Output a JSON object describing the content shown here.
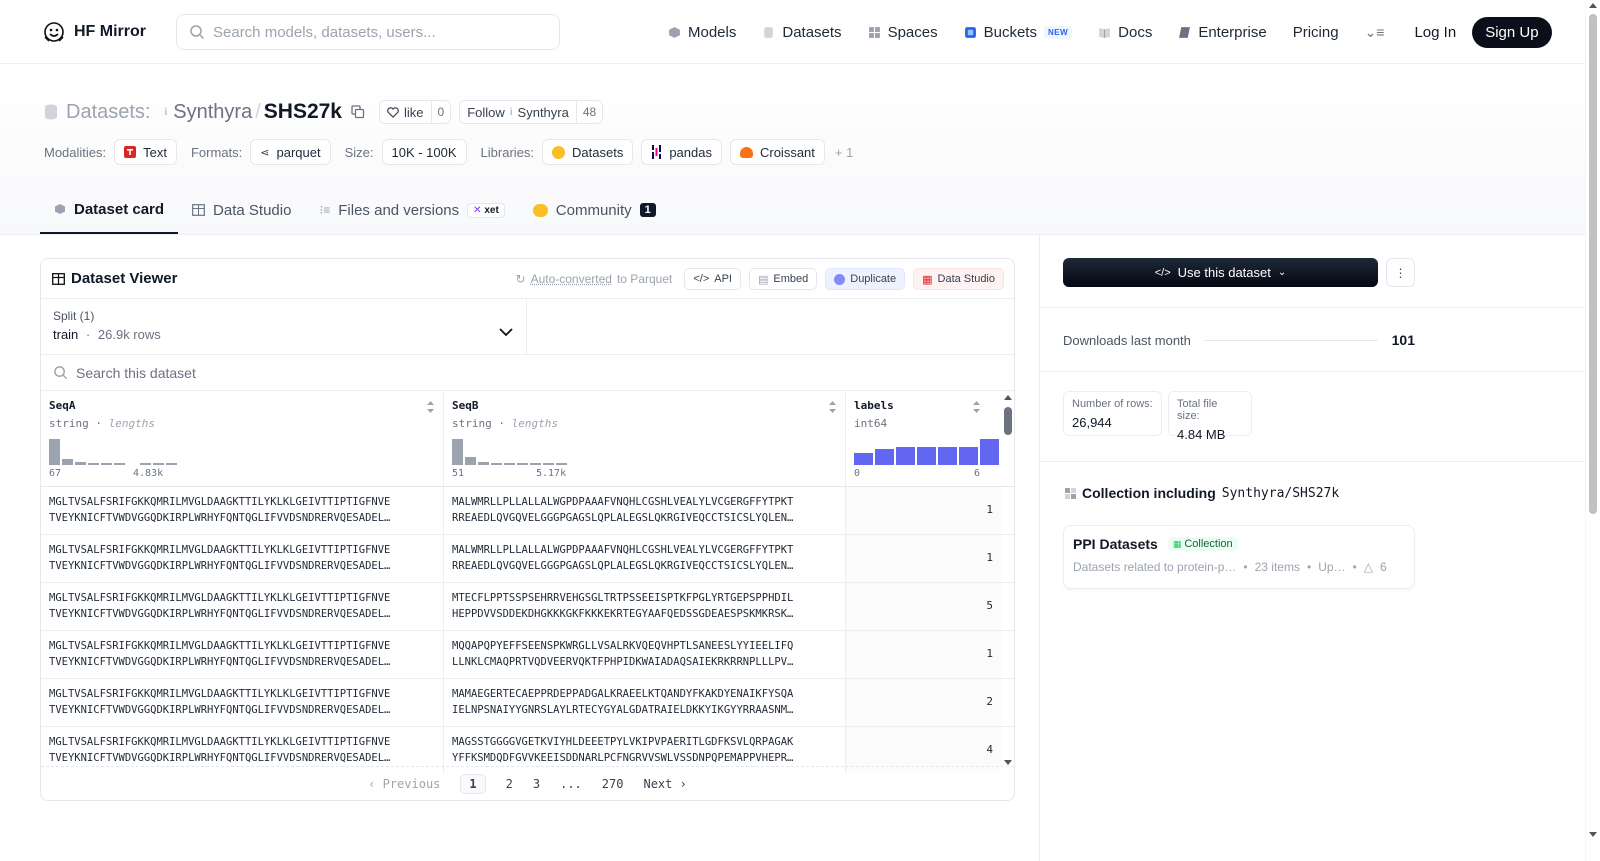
{
  "nav": {
    "brand": "HF Mirror",
    "search_placeholder": "Search models, datasets, users...",
    "links": [
      {
        "label": "Models"
      },
      {
        "label": "Datasets"
      },
      {
        "label": "Spaces"
      },
      {
        "label": "Buckets",
        "badge": "NEW"
      },
      {
        "label": "Docs"
      },
      {
        "label": "Enterprise"
      },
      {
        "label": "Pricing"
      }
    ],
    "login": "Log In",
    "signup": "Sign Up"
  },
  "header": {
    "datasets_label": "Datasets:",
    "org": "Synthyra",
    "slash": "/",
    "name": "SHS27k",
    "like_label": "like",
    "like_count": "0",
    "follow_label": "Follow",
    "follow_org": "Synthyra",
    "follow_count": "48",
    "modalities_label": "Modalities:",
    "modality": "Text",
    "formats_label": "Formats:",
    "format": "parquet",
    "size_label": "Size:",
    "size": "10K - 100K",
    "libraries_label": "Libraries:",
    "libraries": [
      "Datasets",
      "pandas",
      "Croissant"
    ],
    "more_libraries": "+ 1"
  },
  "tabs": {
    "card": "Dataset card",
    "studio": "Data Studio",
    "files": "Files and versions",
    "xet": "xet",
    "community": "Community",
    "community_count": "1"
  },
  "viewer": {
    "title": "Dataset Viewer",
    "auto_converted": "Auto-converted",
    "to_parquet": "to Parquet",
    "api": "API",
    "embed": "Embed",
    "duplicate": "Duplicate",
    "data_studio": "Data Studio",
    "split_label": "Split (1)",
    "split_name": "train",
    "split_sep": "·",
    "split_rows": "26.9k rows",
    "search_placeholder": "Search this dataset",
    "columns": [
      {
        "name": "SeqA",
        "type": "string",
        "stat": "lengths",
        "min": "67",
        "max": "4.83k",
        "hist": [
          1.0,
          0.22,
          0.1,
          0.06,
          0.05,
          0.04,
          0,
          0.04,
          0.04,
          0.04
        ]
      },
      {
        "name": "SeqB",
        "type": "string",
        "stat": "lengths",
        "min": "51",
        "max": "5.17k",
        "hist": [
          1.0,
          0.3,
          0.1,
          0.06,
          0.05,
          0.05,
          0.05,
          0.04,
          0.04
        ]
      },
      {
        "name": "labels",
        "type": "int64",
        "min": "0",
        "max": "6",
        "hist": [
          0.45,
          0.62,
          0.68,
          0.68,
          0.68,
          0.68,
          1.0
        ]
      }
    ],
    "rows": [
      {
        "a1": "MGLTVSALFSRIFGKKQMRILMVGLDAAGKTTILYKLKLGEIVTTIPTIGFNVE",
        "a2": "TVEYKNICFTVWDVGGQDKIRPLWRHYFQNTQGLIFVVDSNDRERVQESADEL…",
        "b1": "MALWMRLLPLLALLALWGPDPAAAFVNQHLCGSHLVEALYLVCGERGFFYTPKT",
        "b2": "RREAEDLQVGQVELGGGPGAGSLQPLALEGSLQKRGIVEQCCTSICSLYQLEN…",
        "label": "1"
      },
      {
        "a1": "MGLTVSALFSRIFGKKQMRILMVGLDAAGKTTILYKLKLGEIVTTIPTIGFNVE",
        "a2": "TVEYKNICFTVWDVGGQDKIRPLWRHYFQNTQGLIFVVDSNDRERVQESADEL…",
        "b1": "MALWMRLLPLLALLALWGPDPAAAFVNQHLCGSHLVEALYLVCGERGFFYTPKT",
        "b2": "RREAEDLQVGQVELGGGPGAGSLQPLALEGSLQKRGIVEQCCTSICSLYQLEN…",
        "label": "1"
      },
      {
        "a1": "MGLTVSALFSRIFGKKQMRILMVGLDAAGKTTILYKLKLGEIVTTIPTIGFNVE",
        "a2": "TVEYKNICFTVWDVGGQDKIRPLWRHYFQNTQGLIFVVDSNDRERVQESADEL…",
        "b1": "MTECFLPPTSSPSEHRRVEHGSGLTRTPSSEEISPTKFPGLYRTGEPSPPHDIL",
        "b2": "HEPPDVVSDDEKDHGKKKGKFKKKEKRTEGYAAFQEDSSGDEAESPSKMKRSK…",
        "label": "5"
      },
      {
        "a1": "MGLTVSALFSRIFGKKQMRILMVGLDAAGKTTILYKLKLGEIVTTIPTIGFNVE",
        "a2": "TVEYKNICFTVWDVGGQDKIRPLWRHYFQNTQGLIFVVDSNDRERVQESADEL…",
        "b1": "MQQAPQPYEFFSEENSPKWRGLLVSALRKVQEQVHPTLSANEESLYYIEELIFQ",
        "b2": "LLNKLCMAQPRTVQDVEERVQKTFPHPIDKWAIADAQSAIEKRKRRNPLLLPV…",
        "label": "1"
      },
      {
        "a1": "MGLTVSALFSRIFGKKQMRILMVGLDAAGKTTILYKLKLGEIVTTIPTIGFNVE",
        "a2": "TVEYKNICFTVWDVGGQDKIRPLWRHYFQNTQGLIFVVDSNDRERVQESADEL…",
        "b1": "MAMAEGERTECAEPPRDEPPADGALKRAEELKTQANDYFKAKDYENAIKFYSQA",
        "b2": "IELNPSNAIYYGNRSLAYLRTECYGYALGDATRAIELDKKYIKGYYRRAASNM…",
        "label": "2"
      },
      {
        "a1": "MGLTVSALFSRIFGKKQMRILMVGLDAAGKTTILYKLKLGEIVTTIPTIGFNVE",
        "a2": "TVEYKNICFTVWDVGGQDKIRPLWRHYFQNTQGLIFVVDSNDRERVQESADEL…",
        "b1": "MAGSSTGGGGVGETKVIYHLDEEETPYLVKIPVPAERITLGDFKSVLQRPAGAK",
        "b2": "YFFKSMDQDFGVVKEEISDDNARLPCFNGRVVSWLVSSDNPQPEMAPPVHEPR…",
        "label": "4"
      }
    ],
    "pager": {
      "prev": "Previous",
      "pages": [
        "1",
        "2",
        "3",
        "...",
        "270"
      ],
      "next": "Next"
    }
  },
  "sidebar": {
    "use_button": "Use this dataset",
    "downloads_label": "Downloads last month",
    "downloads_value": "101",
    "rows_label": "Number of rows:",
    "rows_value": "26,944",
    "size_label": "Total file size:",
    "size_value": "4.84 MB",
    "collection_heading": "Collection including",
    "collection_repo": "Synthyra/SHS27k",
    "collection_name": "PPI Datasets",
    "collection_badge": "Collection",
    "collection_desc": "Datasets related to protein-p…",
    "collection_items": "23 items",
    "collection_updated": "Up…",
    "collection_likes": "6"
  }
}
